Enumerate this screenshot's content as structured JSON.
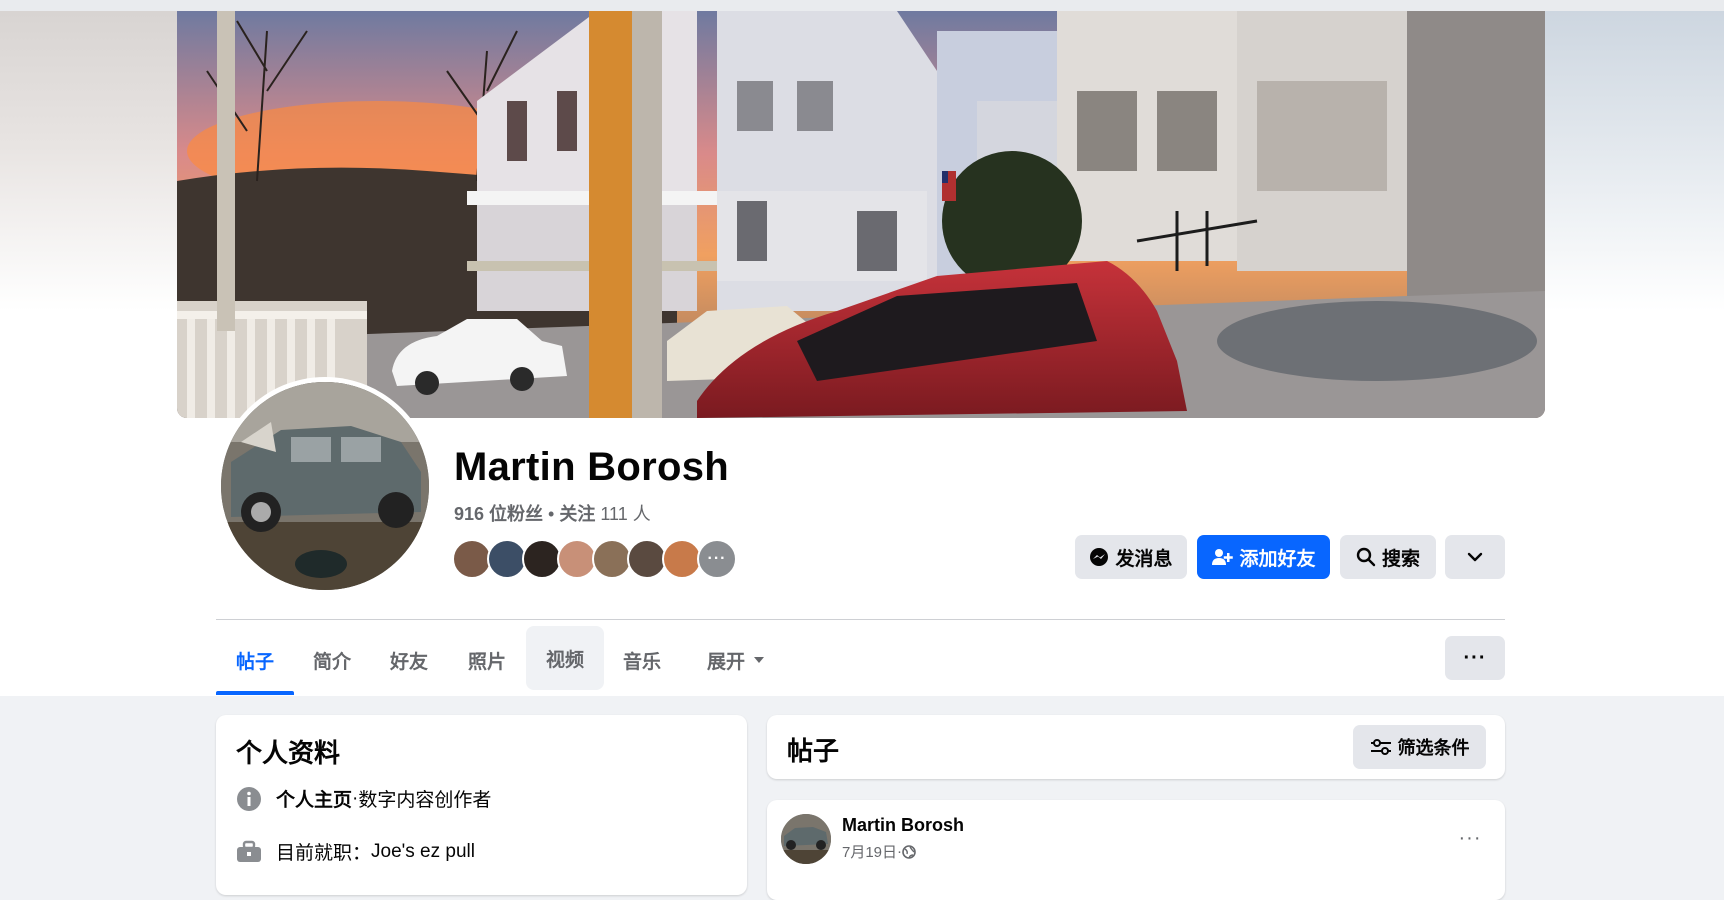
{
  "profile": {
    "name": "Martin Borosh",
    "followers_label": "916 位粉丝",
    "separator": " • ",
    "following_prefix": "关注 ",
    "following_count": "111",
    "following_suffix": " 人"
  },
  "actions": {
    "message": "发消息",
    "add_friend": "添加好友",
    "search": "搜索"
  },
  "tabs": [
    {
      "label": "帖子"
    },
    {
      "label": "简介"
    },
    {
      "label": "好友"
    },
    {
      "label": "照片"
    },
    {
      "label": "视频"
    },
    {
      "label": "音乐"
    },
    {
      "label": "展开"
    }
  ],
  "intro": {
    "title": "个人资料",
    "page_label": "个人主页",
    "page_sep": " · ",
    "page_category": "数字内容创作者",
    "work_label": "目前就职：",
    "work_value": "Joe's ez pull"
  },
  "posts": {
    "title": "帖子",
    "filter_label": "筛选条件",
    "first_post": {
      "author": "Martin Borosh",
      "date": "7月19日",
      "date_sep": " · ",
      "audience_icon": "globe-icon"
    }
  },
  "colors": {
    "accent_blue": "#0866ff",
    "button_gray": "#e4e6eb",
    "secondary_text": "#65676b",
    "page_bg": "#f0f2f5"
  }
}
